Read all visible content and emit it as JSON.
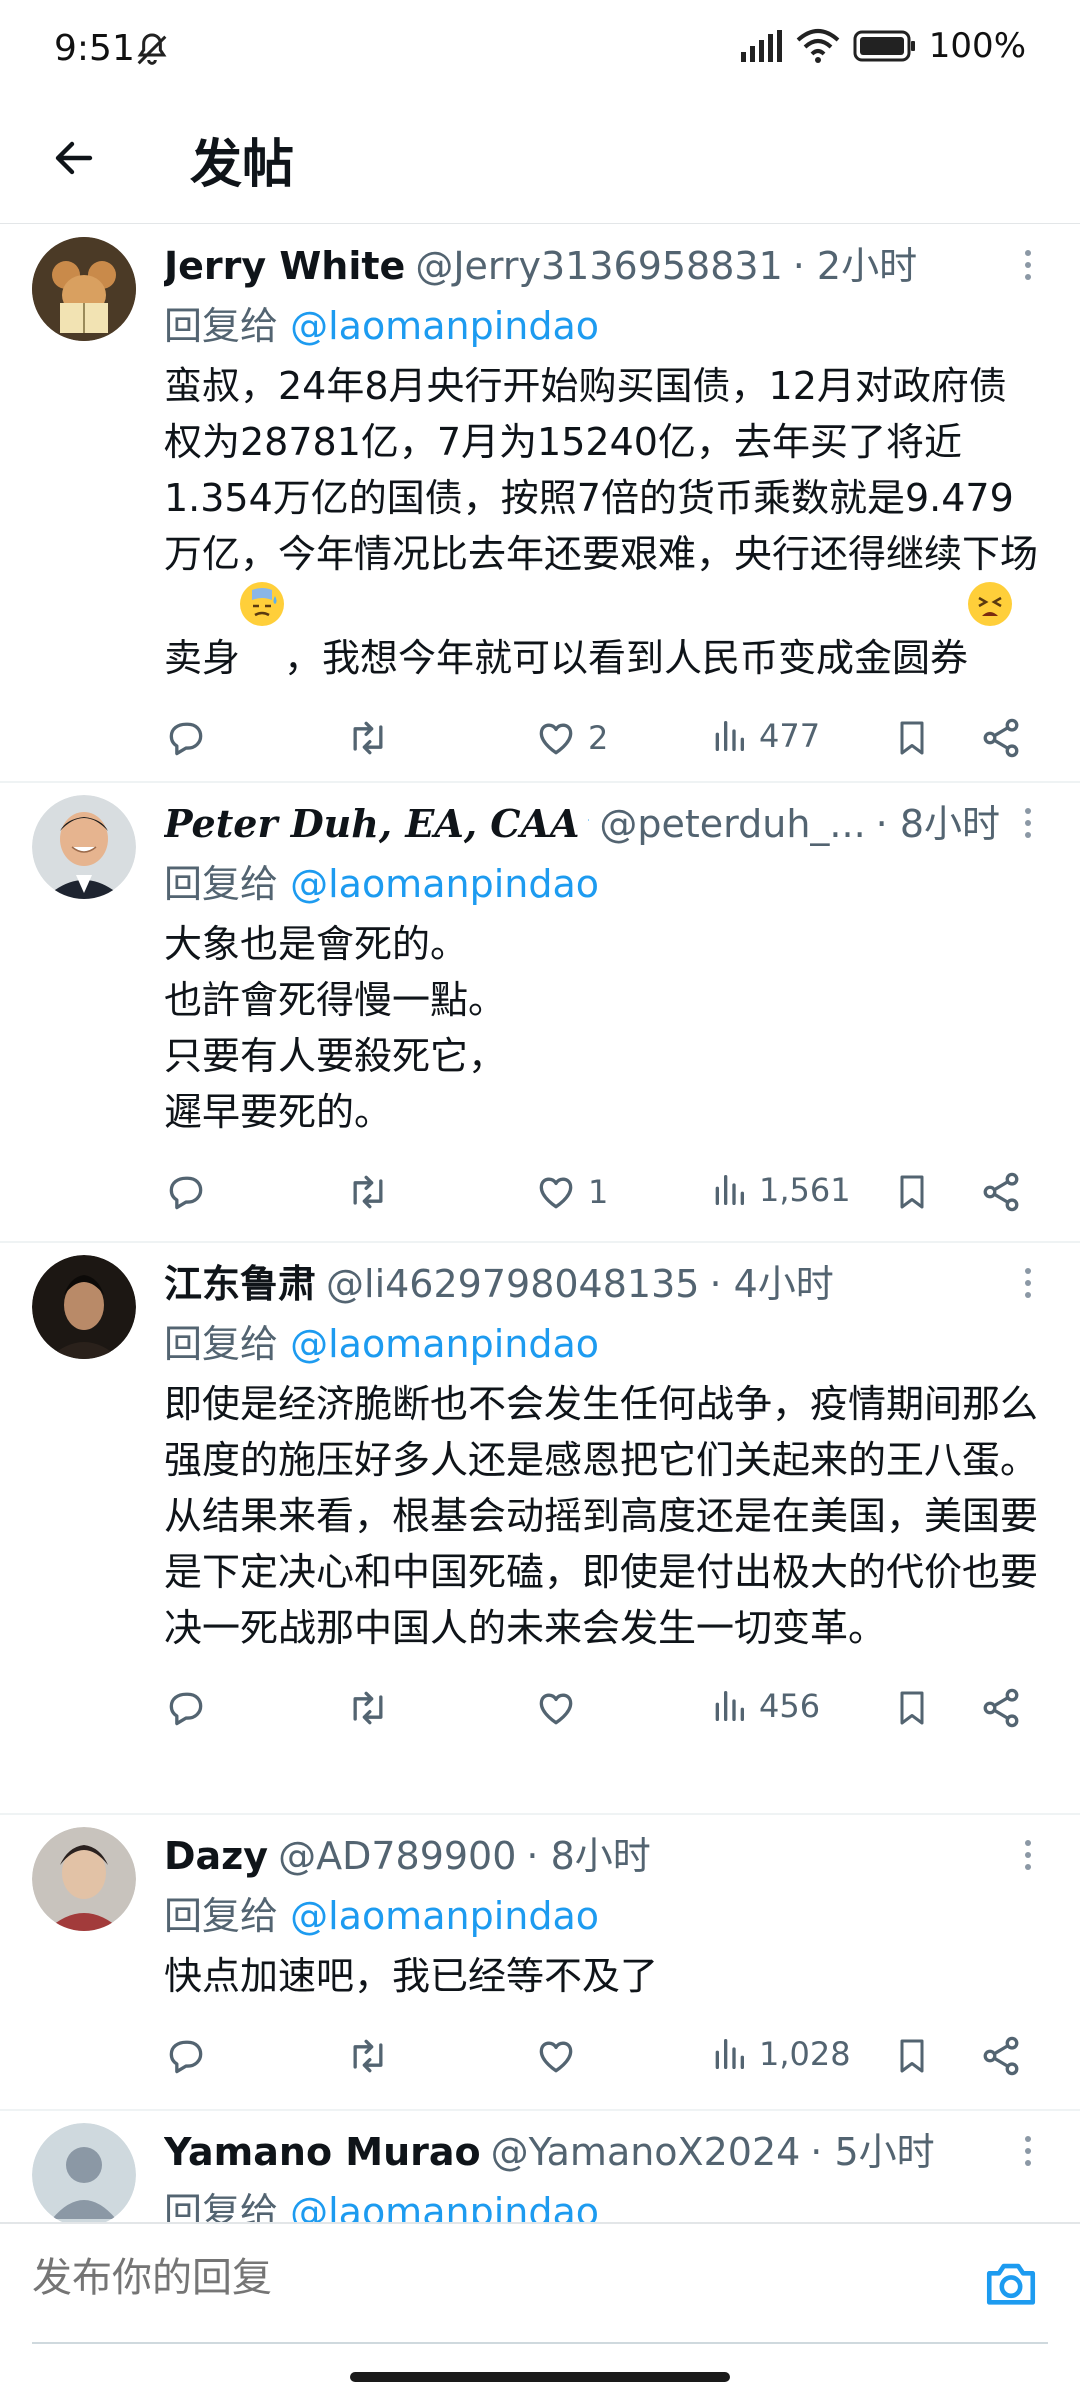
{
  "status_bar": {
    "time": "9:51",
    "battery": "100%"
  },
  "header": {
    "title": "发帖"
  },
  "posts": [
    {
      "name": "Jerry White",
      "handle": "@Jerry3136958831",
      "time": "· 2小时",
      "reply_prefix": "回复给 ",
      "reply_to": "@laomanpindao",
      "text_part1": "蛮叔，24年8月央行开始购买国债，12月对政府债权为28781亿，7月为15240亿，去年买了将近1.354万亿的国债，按照7倍的货币乘数就是9.479万亿，今年情况比去年还要艰难，央行还得继续下场卖身",
      "text_part2": "，我想今年就可以看到人民币变成金圆券",
      "likes": "2",
      "views": "477"
    },
    {
      "name": "Peter Duh, EA, CAA",
      "handle": "@peterduh_...",
      "time": "· 8小时",
      "reply_prefix": "回复给 ",
      "reply_to": "@laomanpindao",
      "text": "大象也是會死的。\n也許會死得慢一點。\n只要有人要殺死它，\n遲早要死的。",
      "likes": "1",
      "views": "1,561"
    },
    {
      "name": "江东鲁肃",
      "handle": "@li4629798048135",
      "time": "· 4小时",
      "reply_prefix": "回复给 ",
      "reply_to": "@laomanpindao",
      "text": "即使是经济脆断也不会发生任何战争，疫情期间那么强度的施压好多人还是感恩把它们关起来的王八蛋。从结果来看，根基会动摇到高度还是在美国，美国要是下定决心和中国死磕，即使是付出极大的代价也要决一死战那中国人的未来会发生一切变革。",
      "likes": "",
      "views": "456"
    },
    {
      "name": "Dazy",
      "handle": "@AD789900",
      "time": "· 8小时",
      "reply_prefix": "回复给 ",
      "reply_to": "@laomanpindao",
      "text": "快点加速吧，我已经等不及了",
      "likes": "",
      "views": "1,028"
    },
    {
      "name": "Yamano Murao",
      "handle": "@YamanoX2024",
      "time": "· 5小时",
      "reply_prefix": "回复给 ",
      "reply_to": "@laomanpindao"
    }
  ],
  "reply_box": {
    "placeholder": "发布你的回复"
  },
  "colors": {
    "accent": "#1d9bf0",
    "secondary_text": "#536471",
    "divider": "#eff3f4"
  }
}
